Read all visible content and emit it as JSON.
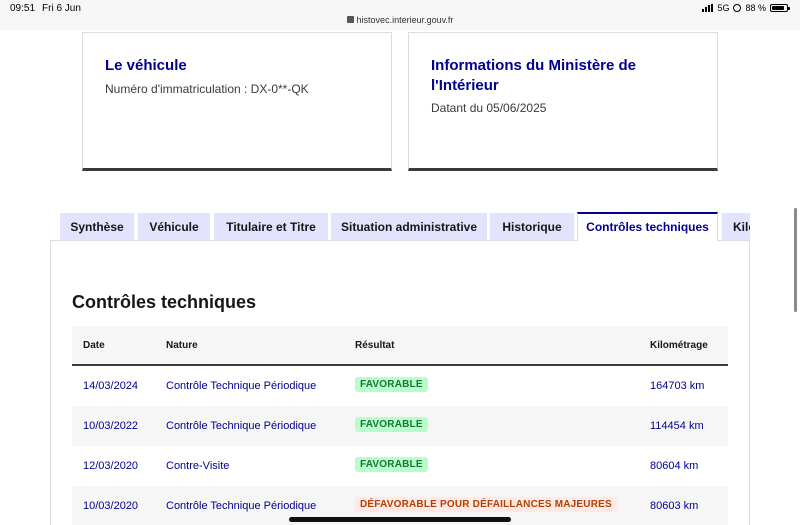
{
  "status_bar": {
    "time": "09:51",
    "date": "Fri 6 Jun",
    "url": "histovec.interieur.gouv.fr",
    "network": "5G",
    "battery": "88 %"
  },
  "vehicle_card": {
    "title": "Le véhicule",
    "plate_text": "Numéro d'immatriculation : DX-0**-QK"
  },
  "ministry_card": {
    "title": "Informations du Ministère de l'Intérieur",
    "date_text": "Datant du 05/06/2025"
  },
  "tabs": [
    {
      "label": "Synthèse",
      "active": false
    },
    {
      "label": "Véhicule",
      "active": false
    },
    {
      "label": "Titulaire et Titre",
      "active": false
    },
    {
      "label": "Situation administrative",
      "active": false
    },
    {
      "label": "Historique",
      "active": false
    },
    {
      "label": "Contrôles techniques",
      "active": true
    },
    {
      "label": "Kilométrage",
      "active": false
    }
  ],
  "section": {
    "title": "Contrôles techniques"
  },
  "table": {
    "headers": {
      "date": "Date",
      "nature": "Nature",
      "result": "Résultat",
      "km": "Kilométrage"
    },
    "rows": [
      {
        "date": "14/03/2024",
        "nature": "Contrôle Technique Périodique",
        "result": "FAVORABLE",
        "status": "success",
        "km": "164703 km"
      },
      {
        "date": "10/03/2022",
        "nature": "Contrôle Technique Périodique",
        "result": "FAVORABLE",
        "status": "success",
        "km": "114454 km"
      },
      {
        "date": "12/03/2020",
        "nature": "Contre-Visite",
        "result": "FAVORABLE",
        "status": "success",
        "km": "80604 km"
      },
      {
        "date": "10/03/2020",
        "nature": "Contrôle Technique Périodique",
        "result": "DÉFAVORABLE POUR DÉFAILLANCES MAJEURES",
        "status": "error",
        "km": "80603 km"
      }
    ]
  },
  "colors": {
    "accent": "#000091",
    "tab_background": "#e3e3fd",
    "success_bg": "#b8fec9",
    "success_text": "#18753c",
    "error_bg": "#ffe9e6",
    "error_text": "#b34000"
  }
}
